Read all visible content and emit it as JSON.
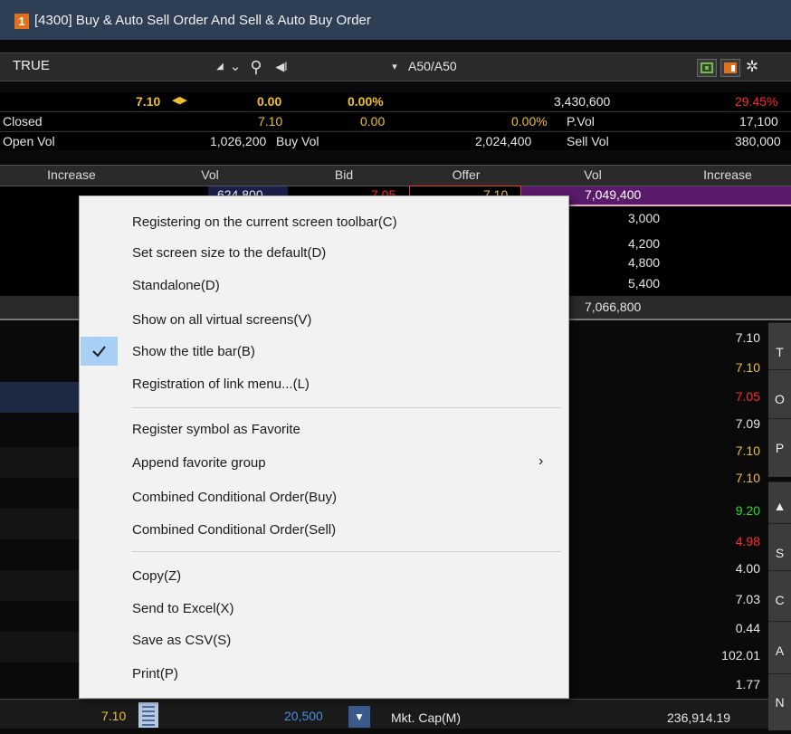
{
  "window": {
    "number": "1",
    "title": "[4300] Buy & Auto Sell Order And Sell & Auto Buy Order"
  },
  "toolbar": {
    "symbol": "TRUE",
    "link": "A50/A50",
    "icons": [
      "dropdown-arrow-icon",
      "search-icon",
      "speaker-icon",
      "grid-icon",
      "layout-icon",
      "gear-icon"
    ]
  },
  "quote": {
    "price": "7.10",
    "change": "0.00",
    "change_pct": "0.00%",
    "volume": "3,430,600",
    "pct_red": "29.45%",
    "closed_label": "Closed",
    "closed": "7.10",
    "closed_chg": "0.00",
    "closed_pct": "0.00%",
    "pvol_label": "P.Vol",
    "pvol": "17,100",
    "openvol_label": "Open Vol",
    "openvol": "1,026,200",
    "buyvol_label": "Buy Vol",
    "buyvol": "2,024,400",
    "sellvol_label": "Sell Vol",
    "sellvol": "380,000"
  },
  "orderbook": {
    "headers": [
      "Increase",
      "Vol",
      "Bid",
      "Offer",
      "Vol",
      "Increase"
    ],
    "row1": {
      "vol": "624,800",
      "bid": "7.05",
      "offer": "7.10",
      "vol2": "7,049,400"
    },
    "offer_vols": [
      "3,000",
      "4,200",
      "4,800",
      "5,400"
    ],
    "total": "7,066,800"
  },
  "right_values": [
    {
      "v": "7.10",
      "c": "#e8e8e8"
    },
    {
      "v": "7.10",
      "c": "#f0c030"
    },
    {
      "v": "7.05",
      "c": "#ff2b2b"
    },
    {
      "v": "7.09",
      "c": "#e8e8e8"
    },
    {
      "v": "7.10",
      "c": "#f0c030"
    },
    {
      "v": "7.10",
      "c": "#f0c030"
    },
    {
      "v": "9.20",
      "c": "#22e022"
    },
    {
      "v": "4.98",
      "c": "#ff2b2b"
    },
    {
      "v": "4.00",
      "c": "#e8e8e8"
    },
    {
      "v": "7.03",
      "c": "#e8e8e8"
    },
    {
      "v": "0.44",
      "c": "#e8e8e8"
    },
    {
      "v": "102.01",
      "c": "#e8e8e8"
    },
    {
      "v": "1.77",
      "c": "#e8e8e8"
    }
  ],
  "side_buttons": [
    "T",
    "O",
    "P",
    "▲",
    "S",
    "C",
    "A",
    "N"
  ],
  "bottom": {
    "price": "7.10",
    "qty": "20,500",
    "mktcap_label": "Mkt. Cap(M)",
    "mktcap": "236,914.19"
  },
  "menu": {
    "groups": [
      [
        "Registering on the current screen toolbar(C)",
        "Set screen size to the default(D)",
        "Standalone(D)",
        "Show on all virtual screens(V)",
        "Show the title bar(B)",
        "Registration of link menu...(L)"
      ],
      [
        "Register symbol as Favorite",
        "Append favorite group",
        "Combined Conditional Order(Buy)",
        "Combined Conditional Order(Sell)"
      ],
      [
        "Copy(Z)",
        "Send to Excel(X)",
        "Save as CSV(S)",
        "Print(P)"
      ]
    ],
    "checked": "Show the title bar(B)",
    "submenu": "Append favorite group"
  },
  "colors": {
    "accent_orange": "#e0701a",
    "purple_bar": "#5a1a6a",
    "price_yellow": "#f0c030",
    "down_red": "#ff2b2b",
    "up_green": "#22e022"
  }
}
